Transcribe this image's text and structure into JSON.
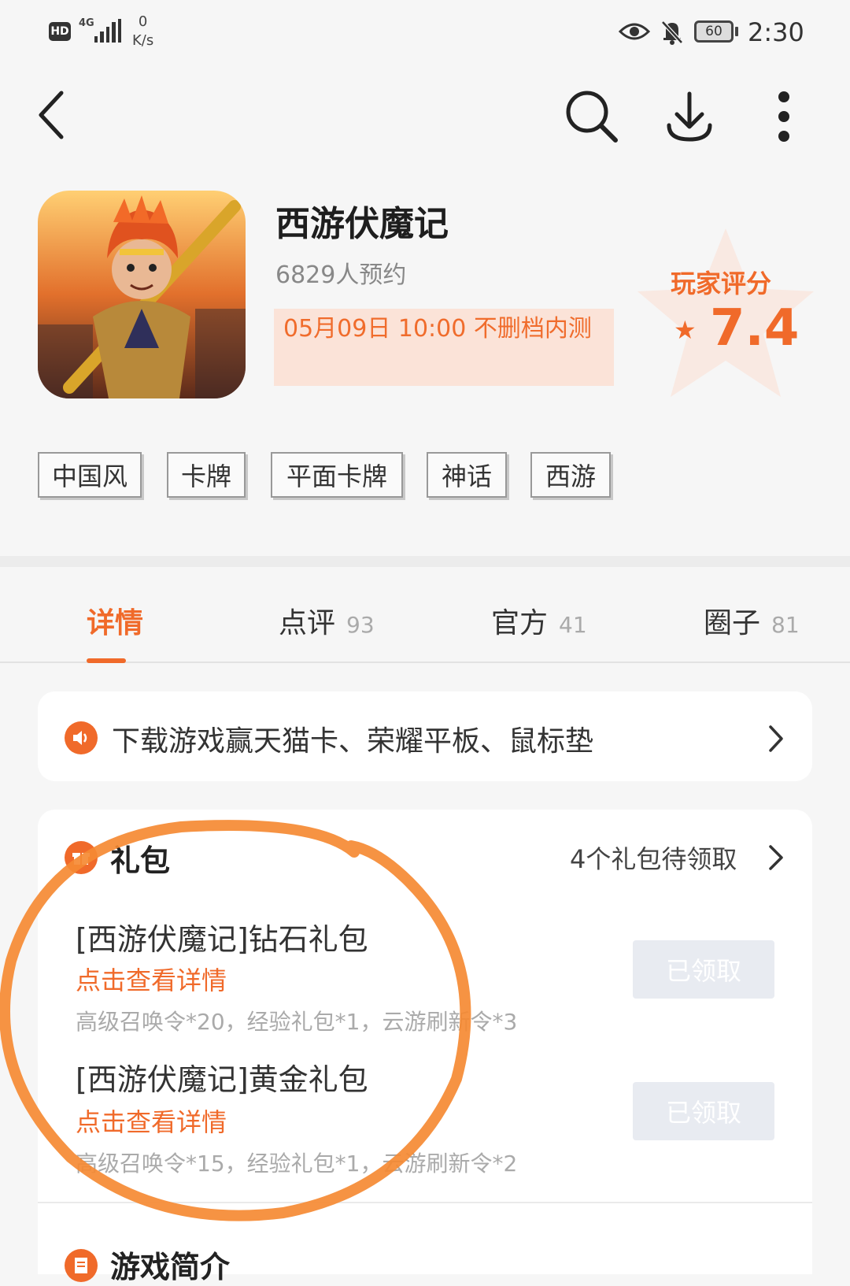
{
  "status_bar": {
    "hd": "HD",
    "network": "4G",
    "speed_value": "0",
    "speed_unit": "K/s",
    "battery": "60",
    "time": "2:30"
  },
  "icons": {
    "back": "back-arrow-icon",
    "search": "search-icon",
    "download": "download-icon",
    "more": "more-vertical-icon",
    "speaker": "speaker-icon",
    "gift": "gift-icon",
    "intro": "document-icon"
  },
  "game": {
    "title": "西游伏魔记",
    "reservations": "6829人预约",
    "test_info": "05月09日 10:00 不删档内测",
    "rating_label": "玩家评分",
    "rating_value": "7.4"
  },
  "tags": [
    "中国风",
    "卡牌",
    "平面卡牌",
    "神话",
    "西游"
  ],
  "tabs": [
    {
      "label": "详情",
      "count": ""
    },
    {
      "label": "点评",
      "count": "93"
    },
    {
      "label": "官方",
      "count": "41"
    },
    {
      "label": "圈子",
      "count": "81"
    }
  ],
  "banner": {
    "text": "下载游戏赢天猫卡、荣耀平板、鼠标垫"
  },
  "gifts": {
    "title": "礼包",
    "pending": "4个礼包待领取",
    "items": [
      {
        "name": "[西游伏魔记]钻石礼包",
        "link": "点击查看详情",
        "contents": "高级召唤令*20，经验礼包*1，云游刷新令*3",
        "button": "已领取"
      },
      {
        "name": "[西游伏魔记]黄金礼包",
        "link": "点击查看详情",
        "contents": "高级召唤令*15，经验礼包*1，云游刷新令*2",
        "button": "已领取"
      }
    ]
  },
  "intro": {
    "title": "游戏简介"
  },
  "colors": {
    "accent": "#f06a2a",
    "annotation": "#f58a33"
  }
}
